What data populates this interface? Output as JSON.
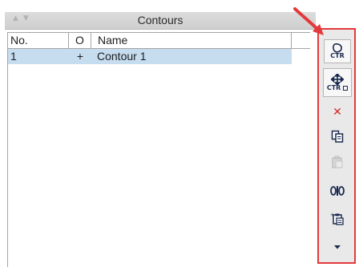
{
  "panel": {
    "title": "Contours",
    "collapse_icons": [
      "triangle-up-icon",
      "triangle-down-icon"
    ]
  },
  "table": {
    "columns": [
      "No.",
      "O",
      "Name"
    ],
    "rows": [
      {
        "no": "1",
        "o": "+",
        "name": "Contour 1",
        "selected": true
      }
    ]
  },
  "toolbar": {
    "buttons": [
      {
        "icon": "new-contour-icon",
        "label": "CTR"
      },
      {
        "icon": "move-contour-icon",
        "label": "CTR"
      },
      {
        "icon": "delete-icon"
      },
      {
        "icon": "copy-icon"
      },
      {
        "icon": "paste-icon",
        "disabled": true
      },
      {
        "icon": "split-icon"
      },
      {
        "icon": "add-copy-icon"
      },
      {
        "icon": "more-chevron-icon"
      }
    ]
  },
  "colors": {
    "highlight": "#e3393c",
    "selection": "#c6dcef",
    "icon": "#1a2a4f"
  }
}
